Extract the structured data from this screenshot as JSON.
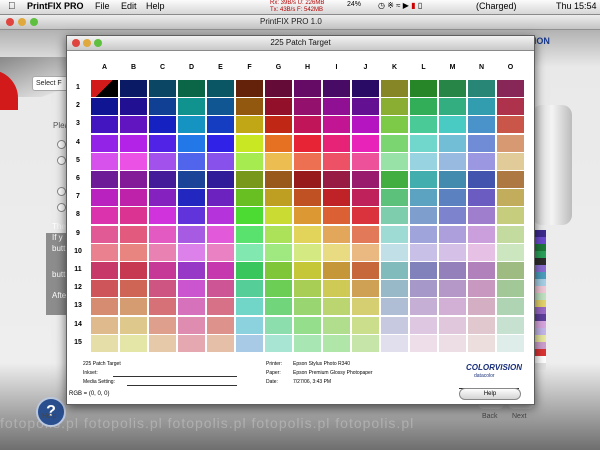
{
  "menubar": {
    "app_name": "PrintFIX PRO",
    "menus": [
      "File",
      "Edit",
      "Help"
    ],
    "net_rx": "Rx:  39B/s  U: 226MB",
    "net_tx": "Tx:  43B/s  F: 542MB",
    "battery_percent": "24%",
    "charge_status": "(Charged)",
    "clock": "Thu 15:54"
  },
  "background_window": {
    "title": "PrintFIX PRO 1.0",
    "logo": "COLORVISION",
    "select_label": "Select F",
    "text_fragments": [
      "Plea",
      "The",
      "If y",
      "butt",
      "butt",
      "Afte"
    ],
    "help_label": "Help",
    "back_label": "Back",
    "next_label": "Next",
    "watermark": "fotopolis.pl   fotopolis.pl   fotopolis.pl   fotopolis.pl   fotopolis.pl"
  },
  "dialog": {
    "title": "225 Patch Target",
    "columns": [
      "A",
      "B",
      "C",
      "D",
      "E",
      "F",
      "G",
      "H",
      "I",
      "J",
      "K",
      "L",
      "M",
      "N",
      "O"
    ],
    "rows": [
      "1",
      "2",
      "3",
      "4",
      "5",
      "6",
      "7",
      "8",
      "9",
      "10",
      "11",
      "12",
      "13",
      "14",
      "15"
    ],
    "footer": {
      "target_name": "225 Patch Target",
      "inkset_label": "Inkset:",
      "media_label": "Media Setting:",
      "printer_label": "Printer:",
      "printer_value": "Epson Stylus Photo R340",
      "paper_label": "Paper:",
      "paper_value": "Epson Premium Glossy Photopaper",
      "date_label": "Date:",
      "date_value": "7/27/06, 3:43 PM",
      "logo_main": "COLORVISION",
      "logo_sub": "datacolor"
    },
    "rgb_readout": "RGB = (0, 0, 0)",
    "help_button": "Help"
  }
}
